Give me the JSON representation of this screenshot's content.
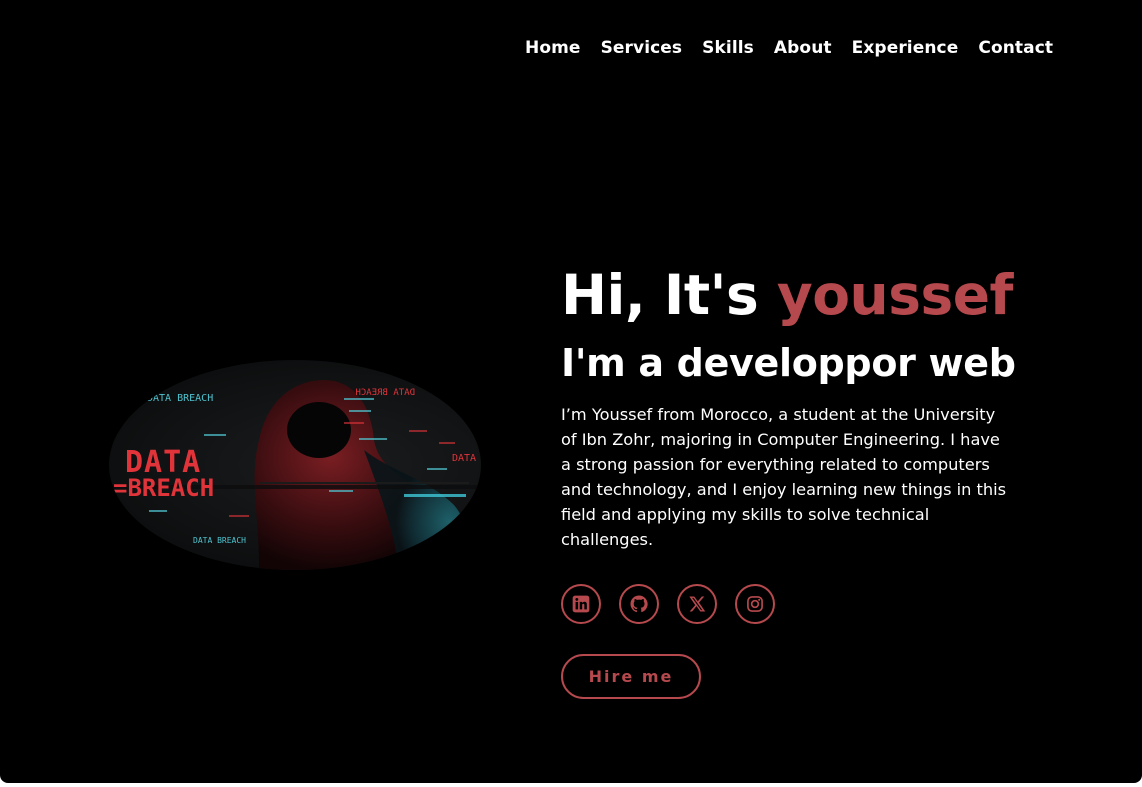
{
  "nav": {
    "items": [
      {
        "label": "Home"
      },
      {
        "label": "Services"
      },
      {
        "label": "Skills"
      },
      {
        "label": "About"
      },
      {
        "label": "Experience"
      },
      {
        "label": "Contact"
      }
    ]
  },
  "hero": {
    "greeting": "Hi, It's",
    "name": "youssef",
    "role": "I'm a developpor web",
    "bio": "I’m Youssef from Morocco, a student at the University of Ibn Zohr, majoring in Computer Engineering. I have a strong passion for everything related to computers and technology, and I enjoy learning new things in this field and applying my skills to solve technical challenges.",
    "image_texts": {
      "big_line1": "DATA",
      "big_line2": "=BREACH",
      "small": "DATA BREACH",
      "right": "DATA",
      "mirrored": "DATA BREACH"
    },
    "hire_label": "Hire me"
  },
  "socials": [
    {
      "icon": "linkedin-icon"
    },
    {
      "icon": "github-icon"
    },
    {
      "icon": "x-icon"
    },
    {
      "icon": "instagram-icon"
    }
  ],
  "colors": {
    "background": "#000000",
    "accent": "#b5494d",
    "text": "#ffffff"
  }
}
